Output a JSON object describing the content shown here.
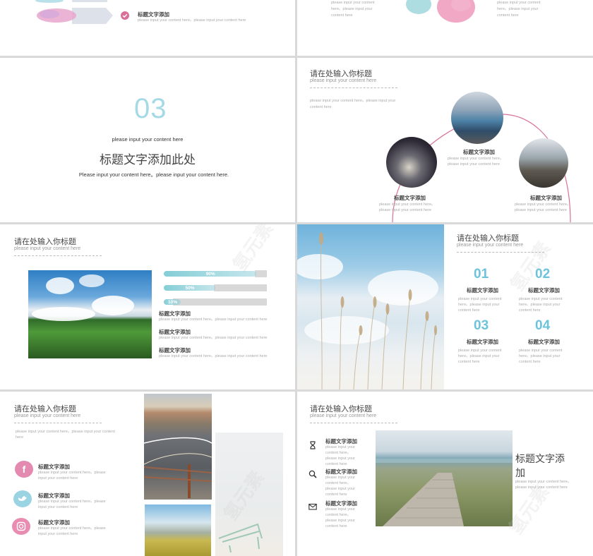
{
  "slide1": {
    "item_title": "标题文字添加",
    "item_text": "please input your content here。please input your content here"
  },
  "slide2": {
    "lines": [
      "please input your content",
      "here。please input your",
      "content here"
    ]
  },
  "slide3": {
    "number": "03",
    "subtitle": "please input your content here",
    "title": "标题文字添加此处",
    "text": "Please input your content here。please input your content here."
  },
  "slide4": {
    "heading": "请在处输入你标题",
    "subheading": "please input your content here",
    "intro": [
      "please input your content here。please input your",
      "content here"
    ],
    "items": [
      {
        "title": "标题文字添加",
        "lines": [
          "please input your content here。",
          "please input your content here"
        ]
      },
      {
        "title": "标题文字添加",
        "lines": [
          "please input your content here。",
          "please input your content here"
        ]
      },
      {
        "title": "标题文字添加",
        "lines": [
          "please input your content here。",
          "please input your content here"
        ]
      }
    ]
  },
  "slide5": {
    "heading": "请在处输入你标题",
    "subheading": "please input your content here",
    "bars": [
      {
        "label": "90%",
        "value": 0.9
      },
      {
        "label": "50%",
        "value": 0.5
      },
      {
        "label": "10%",
        "value": 0.1
      }
    ],
    "items": [
      {
        "title": "标题文字添加",
        "text": "please input your content here。please input your content here"
      },
      {
        "title": "标题文字添加",
        "text": "please input your content here。please input your content here"
      },
      {
        "title": "标题文字添加",
        "text": "please input your content here。please input your content here"
      }
    ]
  },
  "slide6": {
    "heading": "请在处输入你标题",
    "subheading": "please input your content here",
    "items": [
      {
        "num": "01",
        "title": "标题文字添加",
        "lines": [
          "please input your content",
          "here。please input your",
          "content here"
        ]
      },
      {
        "num": "02",
        "title": "标题文字添加",
        "lines": [
          "please input your content",
          "here。please input your",
          "content here"
        ]
      },
      {
        "num": "03",
        "title": "标题文字添加",
        "lines": [
          "please input your content",
          "here。please input your",
          "content here"
        ]
      },
      {
        "num": "04",
        "title": "标题文字添加",
        "lines": [
          "please input your content",
          "here。please input your",
          "content here"
        ]
      }
    ]
  },
  "slide7": {
    "heading": "请在处输入你标题",
    "subheading": "please input your content here",
    "intro": [
      "please input your content here。please input your content",
      "here"
    ],
    "items": [
      {
        "icon": "facebook-icon",
        "title": "标题文字添加",
        "lines": [
          "please input your content here。please",
          "input your content here"
        ]
      },
      {
        "icon": "twitter-icon",
        "title": "标题文字添加",
        "lines": [
          "please input your content here。please",
          "input your content here"
        ]
      },
      {
        "icon": "instagram-icon",
        "title": "标题文字添加",
        "lines": [
          "please input your content here。please",
          "input your content here"
        ]
      }
    ]
  },
  "slide8": {
    "heading": "请在处输入你标题",
    "subheading": "please input your content here",
    "items": [
      {
        "icon": "hourglass-icon",
        "title": "标题文字添加",
        "lines": [
          "please input your",
          "content here。",
          "please input your",
          "content here"
        ]
      },
      {
        "icon": "search-icon",
        "title": "标题文字添加",
        "lines": [
          "please input your",
          "content here。",
          "please input your",
          "content here"
        ]
      },
      {
        "icon": "mail-icon",
        "title": "标题文字添加",
        "lines": [
          "please input your",
          "content here。",
          "please input your",
          "content here"
        ]
      }
    ],
    "big_title_line1": "标题文字添",
    "big_title_line2": "加",
    "big_text": [
      "please input your content here。",
      "please input your content here"
    ]
  },
  "watermark": "氢元素",
  "colors": {
    "accent_pink": "#d9709a",
    "accent_blue": "#6cc4dc",
    "text": "#444444"
  }
}
